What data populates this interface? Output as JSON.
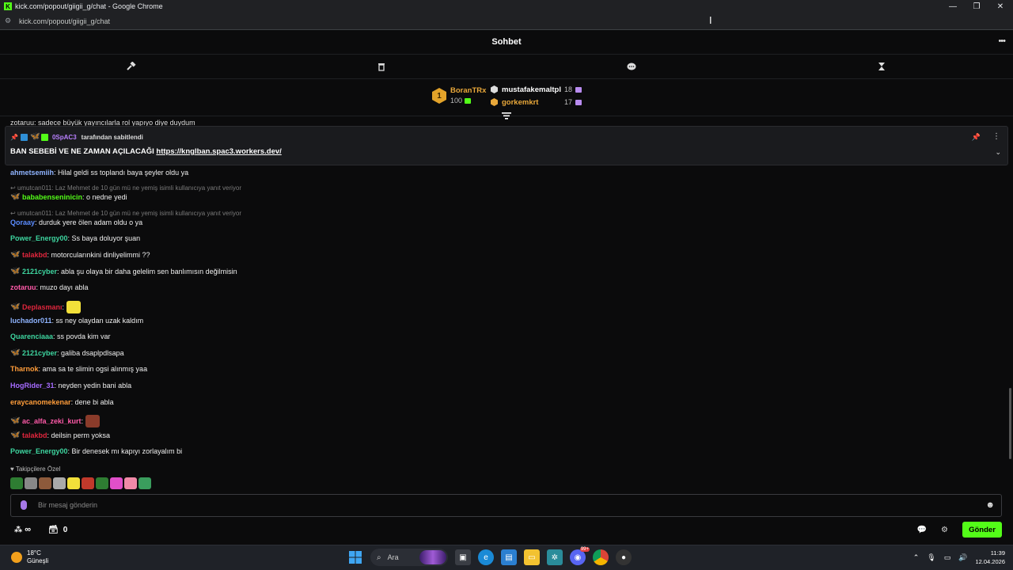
{
  "browser": {
    "window_title": "kick.com/popout/giigii_g/chat - Google Chrome",
    "url": "kick.com/popout/giigii_g/chat"
  },
  "chat": {
    "header_title": "Sohbet"
  },
  "leaderboard": {
    "first": {
      "rank": "1",
      "name": "BoranTRx",
      "count": "100"
    },
    "second": {
      "name": "mustafakemaltpl",
      "count": "18"
    },
    "third": {
      "name": "gorkemkrt",
      "count": "17"
    }
  },
  "partial_message": "zotaruu: sadece büyük yayıncılarla rol yapıyo diye duydum",
  "pinned": {
    "pinned_by_user": "0SpAC3",
    "pinned_by_suffix": "tarafından sabitlendi",
    "message_text": "BAN SEBEBİ VE NE ZAMAN AÇILACAĞI ",
    "message_link": "https://knglban.spac3.workers.dev/"
  },
  "messages": [
    {
      "user": "ahmetsemiih",
      "color": "#8fb4ff",
      "text": ": Hilal geldi ss toplandı baya şeyler oldu ya",
      "badge": false
    },
    {
      "reply": "umutcan011: Laz Mehmet de 10 gün mü ne yemiş isimli kullanıcıya yanıt veriyor",
      "user": "bababenseninicin",
      "color": "#53fc18",
      "text": ": o nedne yedi",
      "badge": true
    },
    {
      "reply": "umutcan011: Laz Mehmet de 10 gün mü ne yemiş isimli kullanıcıya yanıt veriyor",
      "user": "Qoraay",
      "color": "#5b8cff",
      "text": ": durduk yere ölen adam oldu o ya",
      "badge": false
    },
    {
      "user": "Power_Energy00",
      "color": "#3ed6a0",
      "text": ": Ss baya doluyor şuan",
      "badge": false
    },
    {
      "user": "talakbd",
      "color": "#e0263d",
      "text": ": motorcularınkini dinliyelimmi ??",
      "badge": true
    },
    {
      "user": "2121cyber",
      "color": "#3ed6a0",
      "text": ": abla şu olaya bir daha gelelim sen banlımısın değilmisin",
      "badge": true
    },
    {
      "user": "zotaruu",
      "color": "#ff5aa9",
      "text": ": muzo dayı abla",
      "badge": false
    },
    {
      "user": "Deplasmanı",
      "color": "#e0263d",
      "text": ": ",
      "badge": true,
      "emote": "#f2e03a"
    },
    {
      "user": "luchador011",
      "color": "#8fb4ff",
      "text": ": ss ney olaydan uzak kaldım",
      "badge": false
    },
    {
      "user": "Quarenciaaa",
      "color": "#3ed6a0",
      "text": ": ss povda kim var",
      "badge": false
    },
    {
      "user": "2121cyber",
      "color": "#3ed6a0",
      "text": ": galiba dsaplpdlsapa",
      "badge": true
    },
    {
      "user": "Tharnok",
      "color": "#ff9d3a",
      "text": ": ama sa te slimin ogsi alınmış yaa",
      "badge": false
    },
    {
      "user": "HogRider_31",
      "color": "#a56bff",
      "text": ": neyden yedin bani abla",
      "badge": false
    },
    {
      "user": "eraycanomekenar",
      "color": "#ff9d3a",
      "text": ": dene bi abla",
      "badge": false
    },
    {
      "user": "ac_alfa_zeki_kurt",
      "color": "#ff5aa9",
      "text": ": ",
      "badge": true,
      "emote": "#8a3b2a"
    },
    {
      "user": "talakbd",
      "color": "#e0263d",
      "text": ": deilsin perm yoksa",
      "badge": true
    },
    {
      "user": "Power_Energy00",
      "color": "#3ed6a0",
      "text": ": Bir denesek mı kapıyı zorlayalım bi",
      "badge": false
    }
  ],
  "followers_only_label": "Takipçilere Özel",
  "emote_colors": [
    "#2e7d32",
    "#888888",
    "#8d5a3b",
    "#aaaaaa",
    "#f2e03a",
    "#c0392b",
    "#2e7d32",
    "#e04fc9",
    "#f08aa8",
    "#3a9d5d"
  ],
  "input": {
    "placeholder": "Bir mesaj gönderin"
  },
  "bottom": {
    "chest_count": "0",
    "send_label": "Gönder"
  },
  "taskbar": {
    "temperature": "18°C",
    "weather_desc": "Güneşli",
    "search_placeholder": "Ara",
    "notification_badge": "99+",
    "time": "11:39",
    "date": "12.04.2026"
  },
  "colors": {
    "accent": "#53fc18",
    "background": "#0b0b0c",
    "leader_gold": "#e9a83a",
    "pinned_user": "#b980ff"
  }
}
